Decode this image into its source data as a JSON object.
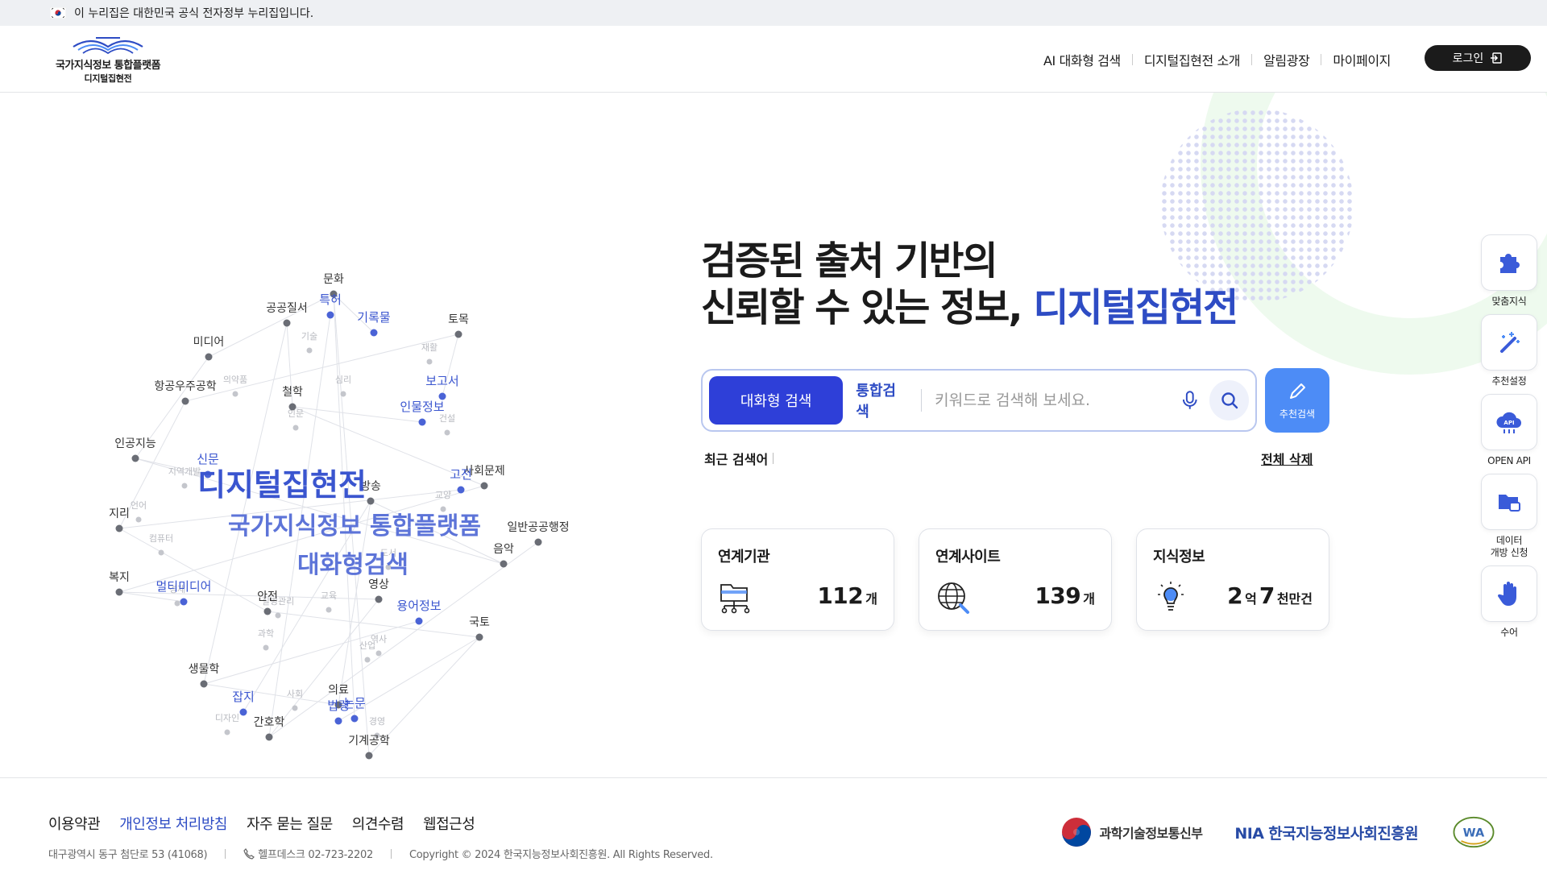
{
  "gov_banner": {
    "text": "이 누리집은 대한민국 공식 전자정부 누리집입니다."
  },
  "logo": {
    "line1": "국가지식정보 통합플랫폼",
    "line2": "디지털집현전"
  },
  "nav": {
    "items": [
      "AI 대화형 검색",
      "디지털집현전 소개",
      "알림광장",
      "마이페이지"
    ],
    "login_label": "로그인"
  },
  "keyword_cloud": {
    "center_labels": [
      "디지털집현전",
      "국가지식정보 통합플랫폼",
      "대화형검색"
    ],
    "dark_labels": [
      "문화",
      "공공질서",
      "토목",
      "미디어",
      "철학",
      "항공우주공학",
      "인공지능",
      "사회문제",
      "지리",
      "음악",
      "복지",
      "안전",
      "방송",
      "영상",
      "국토",
      "의료",
      "간호학",
      "기계공학",
      "생물학",
      "일반공공행정"
    ],
    "blue_labels": [
      "기록물",
      "보고서",
      "인물정보",
      "신문",
      "고전",
      "멀티미디어",
      "잡지",
      "법령",
      "특허",
      "용어정보",
      "논문"
    ],
    "faint_labels": [
      "기술",
      "재활",
      "의약품",
      "심리",
      "인문",
      "건설",
      "지역개발",
      "언어",
      "교양",
      "컴퓨터",
      "도서",
      "교육",
      "경제",
      "질병관리",
      "과학",
      "산업",
      "역사",
      "사회",
      "경영",
      "디자인"
    ]
  },
  "hero": {
    "line1": "검증된 출처 기반의",
    "line2_prefix": "신뢰할 수 있는 정보, ",
    "line2_accent": "디지털집현전"
  },
  "search": {
    "tab_conversational": "대화형 검색",
    "tab_unified": "통합검색",
    "placeholder": "키워드로 검색해 보세요.",
    "recommend_label": "추천검색"
  },
  "recent": {
    "label": "최근 검색어",
    "clear_label": "전체 삭제"
  },
  "stats": [
    {
      "label": "연계기관",
      "value": "112",
      "unit": "개"
    },
    {
      "label": "연계사이트",
      "value": "139",
      "unit": "개"
    },
    {
      "label": "지식정보",
      "value_a": "2",
      "unit_a": "억",
      "value_b": "7",
      "unit_b": "천만건"
    }
  ],
  "side_menu": [
    {
      "label": "맞춤지식",
      "icon": "puzzle-icon"
    },
    {
      "label": "추천설정",
      "icon": "magic-wand-icon"
    },
    {
      "label": "OPEN API",
      "icon": "api-cloud-icon"
    },
    {
      "label": "데이터\n개방 신청",
      "label_line1": "데이터",
      "label_line2": "개방 신청",
      "icon": "data-folder-icon"
    },
    {
      "label": "수어",
      "icon": "sign-language-hand-icon"
    }
  ],
  "footer": {
    "links": [
      "이용약관",
      "개인정보 처리방침",
      "자주 묻는 질문",
      "의견수렴",
      "웹접근성"
    ],
    "address": "대구광역시 동구 첨단로 53 (41068)",
    "helpdesk": "헬프데스크 02-723-2202",
    "copyright": "Copyright © 2024 한국지능정보사회진흥원. All Rights Reserved.",
    "msit_label": "과학기술정보통신부",
    "nia_label": "NIA 한국지능정보사회진흥원"
  },
  "colors": {
    "accent": "#2e4cc4",
    "primary_button": "#2e3fd8",
    "recommend_button": "#4d8cf6",
    "dark": "#1b1b1b"
  }
}
